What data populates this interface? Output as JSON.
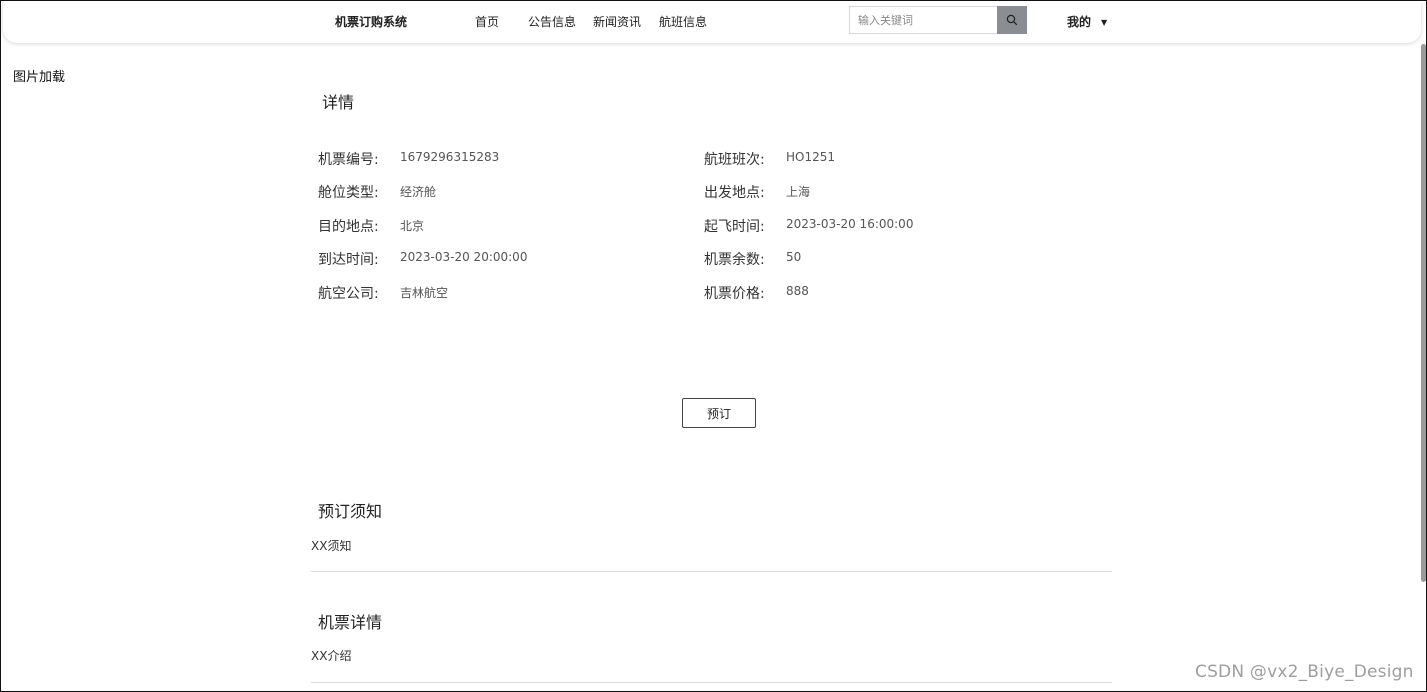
{
  "header": {
    "brand": "机票订购系统",
    "nav": [
      "首页",
      "公告信息",
      "新闻资讯",
      "航班信息"
    ],
    "search_placeholder": "输入关键词",
    "user_menu": "我的"
  },
  "broken_image_text": "图片加载",
  "details": {
    "title": "详情",
    "fields": [
      {
        "label": "机票编号:",
        "value": "1679296315283"
      },
      {
        "label": "航班班次:",
        "value": "HO1251"
      },
      {
        "label": "舱位类型:",
        "value": "经济舱"
      },
      {
        "label": "出发地点:",
        "value": "上海"
      },
      {
        "label": "目的地点:",
        "value": "北京"
      },
      {
        "label": "起飞时间:",
        "value": "2023-03-20 16:00:00"
      },
      {
        "label": "到达时间:",
        "value": "2023-03-20 20:00:00"
      },
      {
        "label": "机票余数:",
        "value": "50"
      },
      {
        "label": "航空公司:",
        "value": "吉林航空"
      },
      {
        "label": "机票价格:",
        "value": "888"
      }
    ]
  },
  "book_button": "预订",
  "notice": {
    "title": "预订须知",
    "text": "XX须知"
  },
  "ticket_detail": {
    "title": "机票详情",
    "text": "XX介绍"
  },
  "watermark": "CSDN @vx2_Biye_Design",
  "icons": {
    "search": "search-icon",
    "dropdown": "caret-down-icon"
  },
  "colors": {
    "search_button": "#8a8d91",
    "divider": "#dcdcdc"
  }
}
